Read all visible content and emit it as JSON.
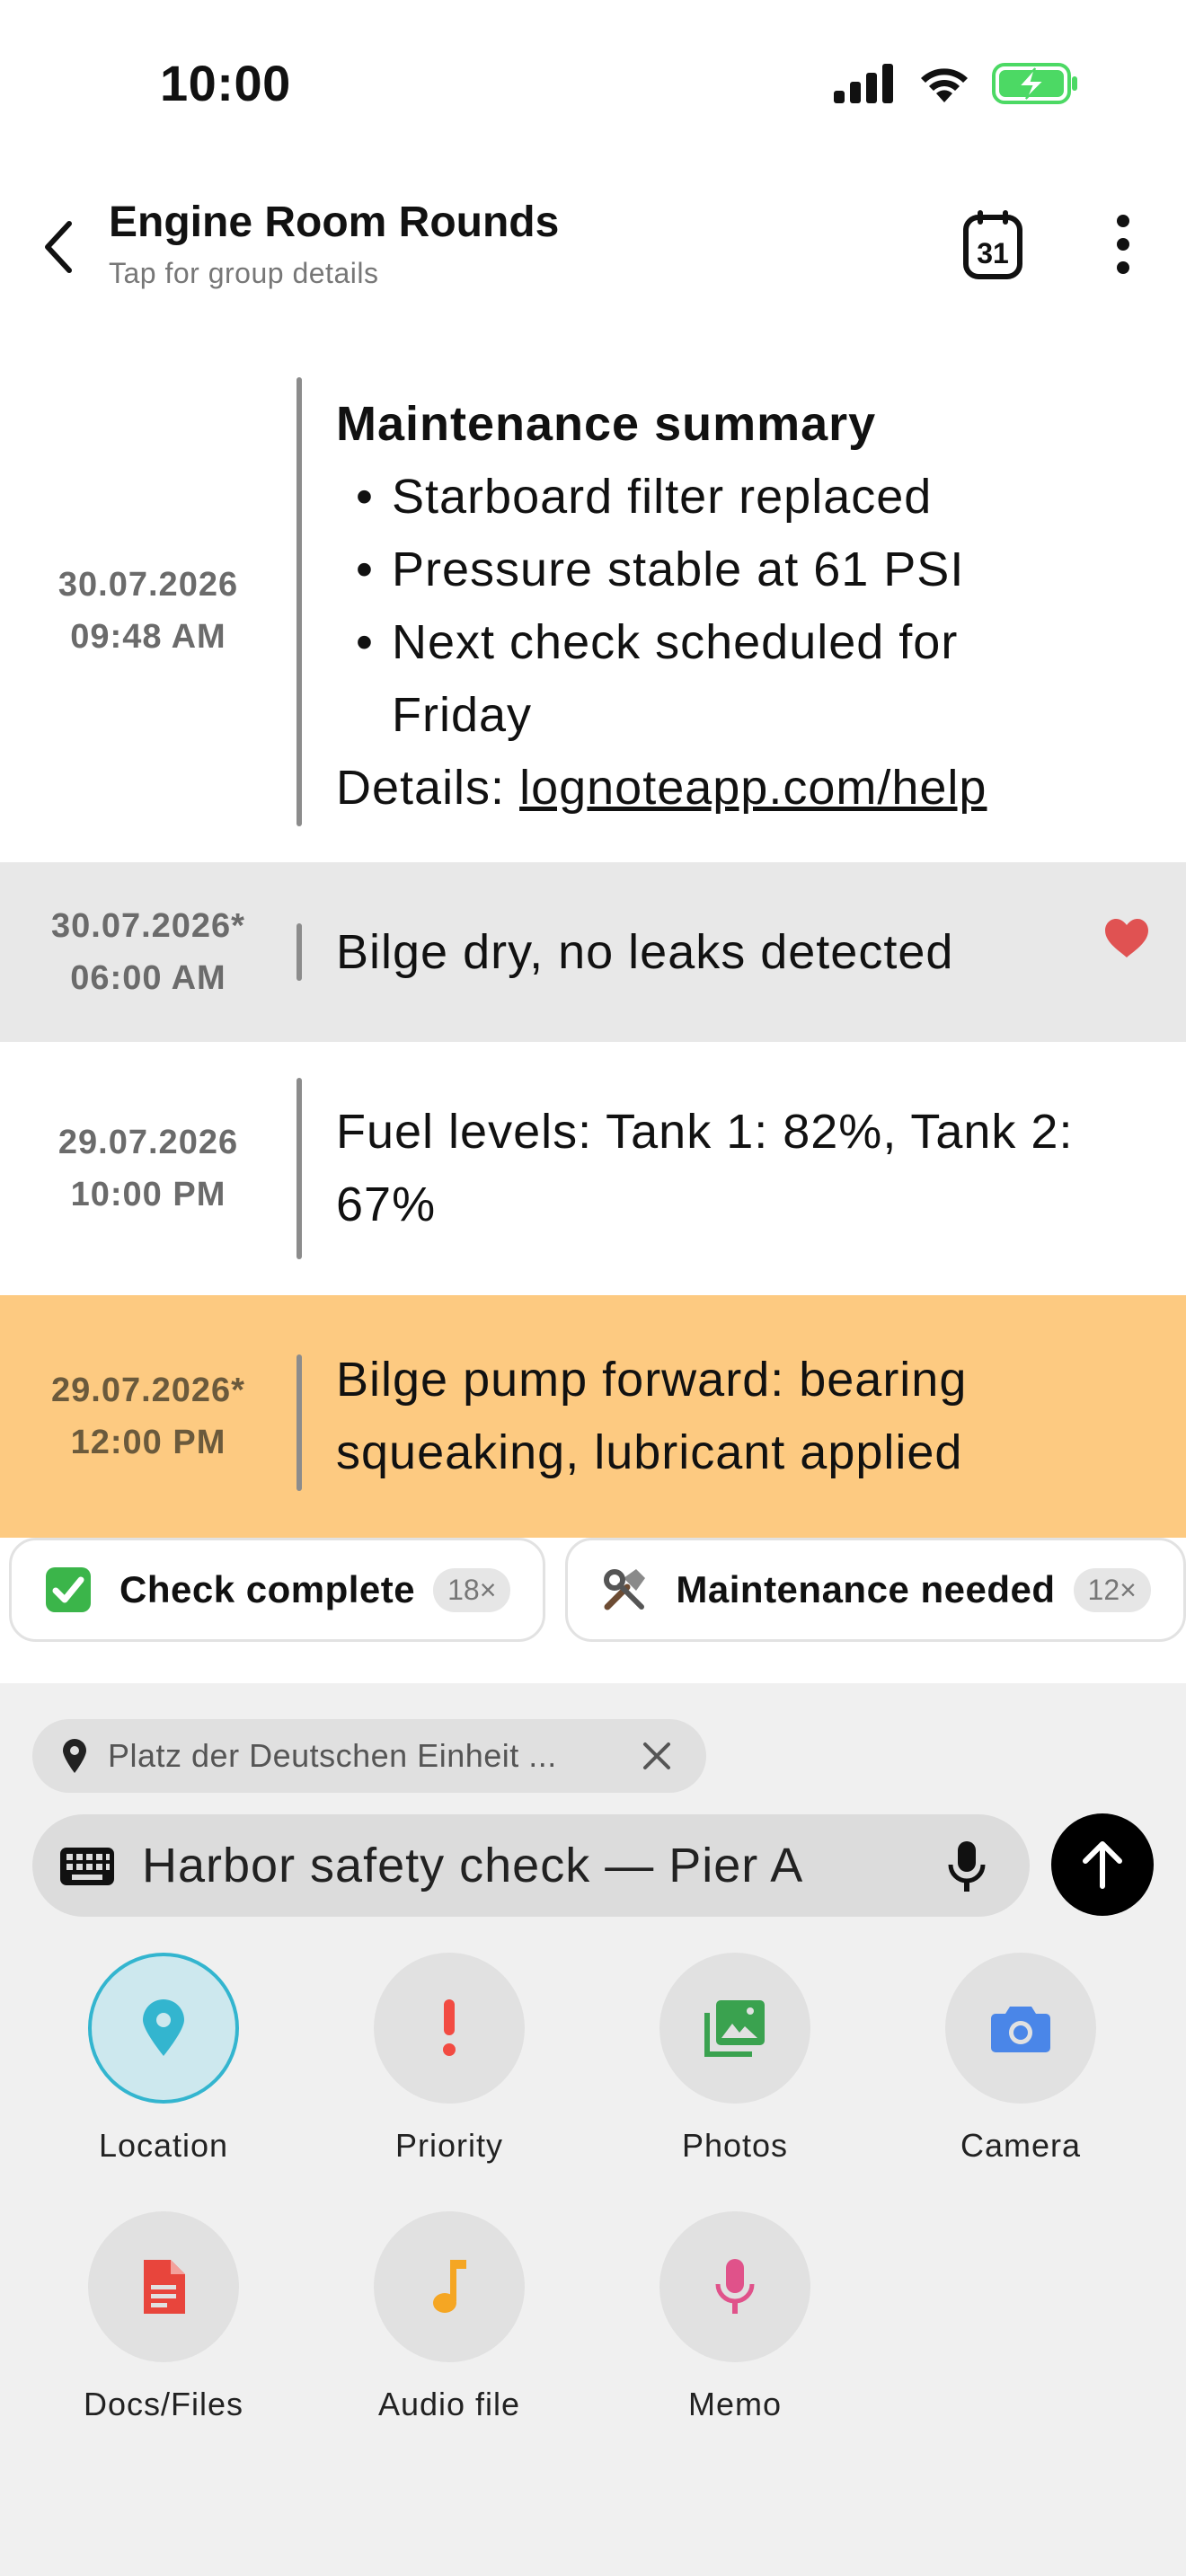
{
  "status_bar": {
    "time": "10:00"
  },
  "header": {
    "title": "Engine Room Rounds",
    "subtitle": "Tap for group details",
    "calendar_day": "31"
  },
  "entries": [
    {
      "date": "30.07.2026",
      "time": "09:48 AM",
      "heading": "Maintenance summary",
      "bullets": [
        "Starboard filter replaced",
        "Pressure stable at 61 PSI",
        "Next check scheduled for",
        "Friday"
      ],
      "bullet_marks": [
        "•",
        "•",
        "•",
        ""
      ],
      "details_label": "Details: ",
      "details_link": "lognoteapp.com/help"
    },
    {
      "date": "30.07.2026*",
      "time": "06:00 AM",
      "text": "Bilge dry, no leaks detected",
      "favorited": true,
      "background": "#e8e8e8"
    },
    {
      "date": "29.07.2026",
      "time": "10:00 PM",
      "text": "Fuel levels: Tank 1: 82%, Tank 2: 67%"
    },
    {
      "date": "29.07.2026*",
      "time": "12:00 PM",
      "text": "Bilge pump forward: bearing squeaking, lubricant applied",
      "background": "#fdca81"
    }
  ],
  "quick_replies": [
    {
      "icon": "check-mark-icon",
      "label": "Check complete",
      "count": "18×"
    },
    {
      "icon": "tools-icon",
      "label": "Maintenance needed",
      "count": "12×"
    }
  ],
  "composer": {
    "location": "Platz der Deutschen Einheit ...",
    "input_value": "Harbor safety check — Pier A"
  },
  "actions": [
    {
      "label": "Location",
      "icon": "location-pin-icon",
      "color": "#33b5cf",
      "active": true
    },
    {
      "label": "Priority",
      "icon": "exclamation-icon",
      "color": "#f24b42"
    },
    {
      "label": "Photos",
      "icon": "photos-icon",
      "color": "#3aa24f"
    },
    {
      "label": "Camera",
      "icon": "camera-icon",
      "color": "#4a86e8"
    },
    {
      "label": "Docs/Files",
      "icon": "document-icon",
      "color": "#e8453c"
    },
    {
      "label": "Audio file",
      "icon": "music-note-icon",
      "color": "#f5a623"
    },
    {
      "label": "Memo",
      "icon": "microphone-icon",
      "color": "#e0528a"
    }
  ],
  "colors": {
    "accent": "#33b5cf",
    "heart": "#e05252",
    "highlight": "#fdca81",
    "battery": "#4cd964"
  }
}
